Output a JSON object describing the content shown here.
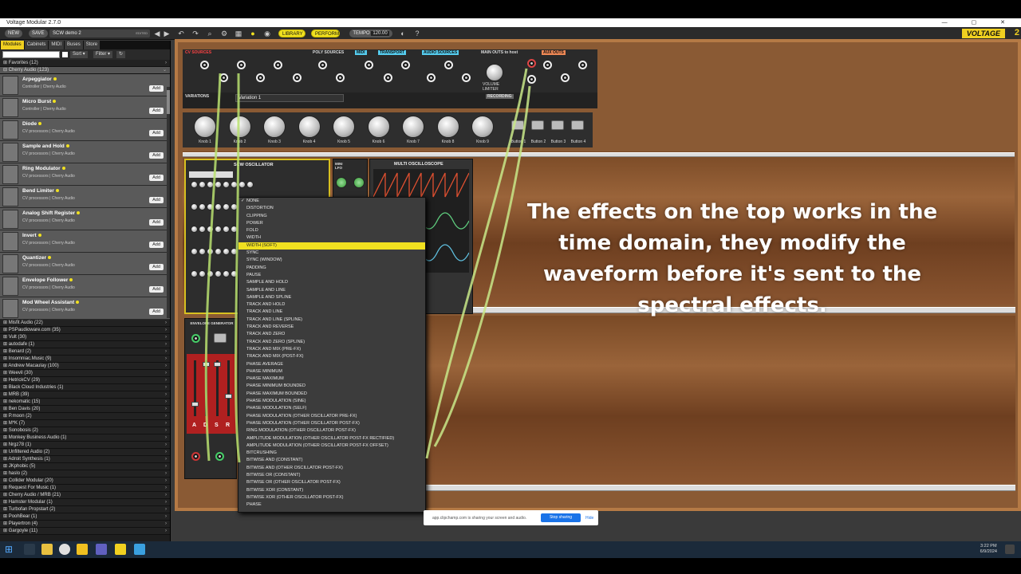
{
  "window": {
    "title": "Voltage Modular 2.7.0"
  },
  "toolbar": {
    "new": "NEW",
    "save": "SAVE",
    "preset": "SCW demo 2",
    "edited": "EDITED",
    "library": "LIBRARY",
    "perform": "PERFORM",
    "tempo_label": "TEMPO",
    "tempo_value": "120.00",
    "logo": "VOLTAGE",
    "logo_num": "2"
  },
  "sidebar": {
    "tabs": [
      "Modules",
      "Cabinets",
      "MIDI",
      "Buses",
      "Store"
    ],
    "sort": "Sort",
    "filter": "Filter",
    "favorites": "Favorites (12)",
    "cherry": "Cherry Audio (123)",
    "modules": [
      {
        "name": "Arpeggiator",
        "cat": "Controller | Cherry Audio"
      },
      {
        "name": "Micro Burst",
        "cat": "Controller | Cherry Audio"
      },
      {
        "name": "Diode",
        "cat": "CV processors | Cherry Audio"
      },
      {
        "name": "Sample and Hold",
        "cat": "CV processors | Cherry Audio"
      },
      {
        "name": "Ring Modulator",
        "cat": "CV processors | Cherry Audio"
      },
      {
        "name": "Bend Limiter",
        "cat": "CV processors | Cherry Audio"
      },
      {
        "name": "Analog Shift Register",
        "cat": "CV processors | Cherry Audio"
      },
      {
        "name": "Invert",
        "cat": "CV processors | Cherry Audio"
      },
      {
        "name": "Quantizer",
        "cat": "CV processors | Cherry Audio"
      },
      {
        "name": "Envelope Follower",
        "cat": "CV processors | Cherry Audio"
      },
      {
        "name": "Mod Wheel Assistant",
        "cat": "CV processors | Cherry Audio"
      }
    ],
    "add_label": "Add",
    "vendors": [
      "Misfit Audio (22)",
      "PSPaudioware.com (35)",
      "Vult (30)",
      "autodafe (1)",
      "Benard (2)",
      "Insomniac.Music (9)",
      "Andrew Macaulay (100)",
      "Weevil (30)",
      "HetrickCV (29)",
      "Black Cloud Industries (1)",
      "MRB (39)",
      "nekomatic (15)",
      "Ben Davis (20)",
      "P.moon (2)",
      "M*K (7)",
      "Sonobosis (2)",
      "Monkey Business Audio (1)",
      "Nrgz78 (1)",
      "Unfiltered Audio (2)",
      "Adroit Synthesis (1)",
      "JKphobic (5)",
      "haslo (2)",
      "Collider Modular (20)",
      "Request For Music (1)",
      "Cherry Audio / MRB (21)",
      "Hamster Modular (1)",
      "Turbofan Propstart (2)",
      "PoohBear (1)",
      "Playertron (4)",
      "Gargoyle (11)"
    ]
  },
  "rack": {
    "cv_sources": "CV SOURCES",
    "poly_sources": "POLY SOURCES",
    "midi": "MIDI",
    "transport": "TRANSPORT",
    "audio_sources": "AUDIO SOURCES",
    "main_outs": "MAIN OUTS",
    "to_host": "to host",
    "aux_outs": "AUX OUTS",
    "variations": "VARIATIONS",
    "variation_name": "Variation 1",
    "recording": "RECORDING",
    "knobs": [
      "Knob 1",
      "Knob 2",
      "Knob 3",
      "Knob 4",
      "Knob 5",
      "Knob 6",
      "Knob 7",
      "Knob 8",
      "Knob 9"
    ],
    "buttons": [
      "Button 1",
      "Button 2",
      "Button 3",
      "Button 4"
    ],
    "scw_osc": "SCW OSCILLATOR",
    "mini_lfo": "MINI LFO",
    "scope": "MULTI OSCILLOSCOPE",
    "envelope": "ENVELOPE GENERATOR",
    "adsr": [
      "A",
      "D",
      "S",
      "R"
    ],
    "volume": "VOLUME",
    "limiter": "LIMITER",
    "cv_labels": [
      "PITCH",
      "GATE",
      "TRIG",
      "VEL",
      "AFTER TOUCH",
      "SUS",
      "BEND",
      "MOD WHEEL"
    ],
    "poly_labels": [
      "POLY PITCH",
      "POLY GATE",
      "POLY VEL",
      "NUMBER OF VOICES"
    ],
    "transport_labels": [
      "PLAY",
      "STOP",
      "SYNC OUT",
      "PLAY GATE"
    ],
    "audio_labels": [
      "1L",
      "2L",
      "1R",
      "2R"
    ],
    "aux_labels": [
      "2L",
      "3L",
      "4L",
      "2R",
      "3R",
      "4R"
    ]
  },
  "dropdown": {
    "items": [
      "NONE",
      "DISTORTION",
      "CLIPPING",
      "POWER",
      "FOLD",
      "WIDTH",
      "WIDTH (SOFT)",
      "SYNC",
      "SYNC (WINDOW)",
      "PADDING",
      "PAUSE",
      "SAMPLE AND HOLD",
      "SAMPLE AND LINE",
      "SAMPLE AND SPLINE",
      "TRACK AND HOLD",
      "TRACK AND LINE",
      "TRACK AND LINE (SPLINE)",
      "TRACK AND REVERSE",
      "TRACK AND ZERO",
      "TRACK AND ZERO (SPLINE)",
      "TRACK AND MIX (PRE-FX)",
      "TRACK AND MIX (POST-FX)",
      "PHASE AVERAGE",
      "PHASE MINIMUM",
      "PHASE MAXIMUM",
      "PHASE MINIMUM BOUNDED",
      "PHASE MAXIMUM BOUNDED",
      "PHASE MODULATION (SINE)",
      "PHASE MODULATION (SELF)",
      "PHASE MODULATION (OTHER OSCILLATOR PRE-FX)",
      "PHASE MODULATION (OTHER OSCILLATOR POST-FX)",
      "RING MODULATION (OTHER OSCILLATOR POST-FX)",
      "AMPLITUDE MODULATION (OTHER OSCILLATOR POST-FX RECTIFIED)",
      "AMPLITUDE MODULATION (OTHER OSCILLATOR POST-FX OFFSET)",
      "BITCRUSHING",
      "BITWISE AND (CONSTANT)",
      "BITWISE AND (OTHER OSCILLATOR POST-FX)",
      "BITWISE OR (CONSTANT)",
      "BITWISE OR (OTHER OSCILLATOR POST-FX)",
      "BITWISE XOR (CONSTANT)",
      "BITWISE XOR (OTHER OSCILLATOR POST-FX)",
      "PHASE"
    ],
    "checked": "NONE",
    "highlighted": "WIDTH (SOFT)"
  },
  "overlay": {
    "line1": "The effects on the top works in the",
    "line2": "time domain, they modify the",
    "line3": "waveform before it's sent to the",
    "line4": "spectral effects."
  },
  "sharebar": {
    "text": "app.clipchamp.com is sharing your screen and audio.",
    "stop": "Stop sharing",
    "hide": "Hide"
  },
  "taskbar": {
    "time": "3:22 PM",
    "date": "6/9/2024"
  },
  "colors": {
    "accent": "#f0e020",
    "cable": "#b8e070",
    "wood": "#8a5a34"
  }
}
